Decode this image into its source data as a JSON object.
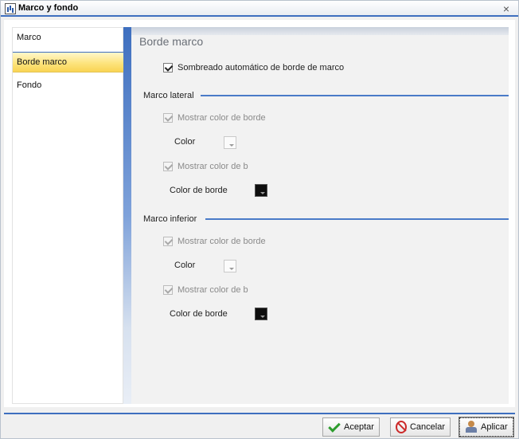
{
  "window": {
    "title": "Marco y fondo"
  },
  "nav": {
    "items": [
      {
        "label": "Marco",
        "selected": false
      },
      {
        "label": "Borde marco",
        "selected": true
      },
      {
        "label": "Fondo",
        "selected": false
      }
    ]
  },
  "content": {
    "title": "Borde marco",
    "auto_shadow": {
      "label": "Sombreado automático de borde de marco",
      "checked": true
    },
    "lateral": {
      "title": "Marco lateral",
      "show_border_color_1": {
        "label": "Mostrar color de borde",
        "checked": true,
        "disabled": true
      },
      "color_label": "Color",
      "show_border_color_2": {
        "label": "Mostrar color de b",
        "checked": true,
        "disabled": true
      },
      "border_color_label": "Color de borde"
    },
    "inferior": {
      "title": "Marco inferior",
      "show_border_color_1": {
        "label": "Mostrar color de borde",
        "checked": true,
        "disabled": true
      },
      "color_label": "Color",
      "show_border_color_2": {
        "label": "Mostrar color de b",
        "checked": true,
        "disabled": true
      },
      "border_color_label": "Color de borde"
    }
  },
  "footer": {
    "accept_label": "Aceptar",
    "cancel_label": "Cancelar",
    "apply_label": "Aplicar"
  },
  "colors": {
    "accent": "#3e6fbf",
    "selected_item": "#fde47e",
    "border_color_swatch": "#0e0e0e"
  }
}
